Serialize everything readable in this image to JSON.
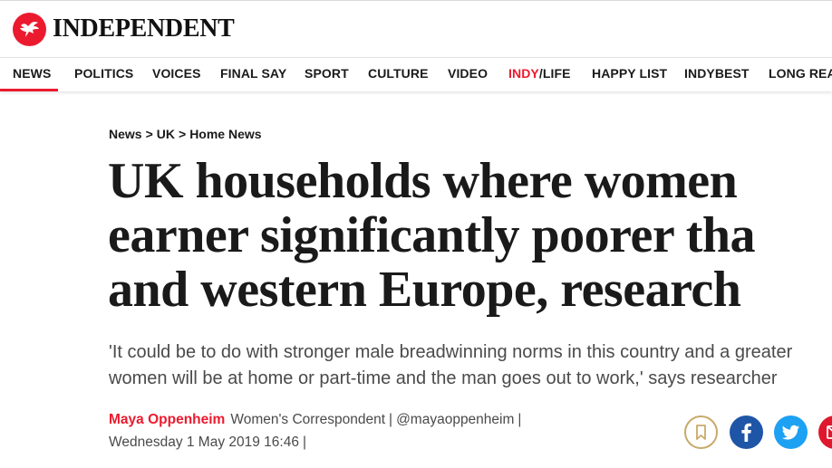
{
  "brand": {
    "name": "INDEPENDENT",
    "accent_color": "#ec1a2e",
    "logo_icon": "eagle-logo-icon"
  },
  "nav": {
    "items": [
      {
        "label": "NEWS",
        "active": true
      },
      {
        "label": "POLITICS"
      },
      {
        "label": "VOICES"
      },
      {
        "label": "FINAL SAY"
      },
      {
        "label": "SPORT"
      },
      {
        "label": "CULTURE"
      },
      {
        "label": "VIDEO"
      },
      {
        "label_part1": "INDY",
        "label_part2": "/LIFE"
      },
      {
        "label": "HAPPY LIST"
      },
      {
        "label": "INDYBEST"
      },
      {
        "label": "LONG REAI"
      }
    ]
  },
  "breadcrumb": {
    "items": [
      "News",
      "UK",
      "Home News"
    ],
    "separator": ">"
  },
  "article": {
    "headline_lines": [
      "UK households where women",
      "earner significantly poorer tha",
      "and western Europe, research"
    ],
    "standfirst_lines": [
      "'It could be to do with stronger male breadwinning norms in this country and a greater",
      "women will be at home or part-time and the man goes out to work,' says researcher"
    ],
    "author": "Maya Oppenheim",
    "author_role": "Women's Correspondent",
    "author_handle": "@mayaoppenheim",
    "separator": "|",
    "date": "Wednesday 1 May 2019 16:46"
  },
  "share": {
    "icons": [
      "bookmark-icon",
      "facebook-icon",
      "twitter-icon",
      "email-icon"
    ],
    "colors": {
      "bookmark_border": "#c9a96b",
      "facebook": "#1f55a6",
      "twitter": "#1da1f2",
      "email": "#e0182d"
    }
  }
}
